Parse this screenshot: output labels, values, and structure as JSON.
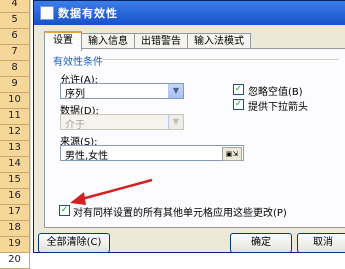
{
  "spreadsheet": {
    "row_numbers": [
      "4",
      "5",
      "6",
      "7",
      "8",
      "9",
      "10",
      "11",
      "12",
      "13",
      "14",
      "15",
      "16",
      "17",
      "18",
      "19",
      "20"
    ]
  },
  "dialog": {
    "title": "数据有效性",
    "tabs": [
      {
        "label": "设置",
        "active": true
      },
      {
        "label": "输入信息",
        "active": false
      },
      {
        "label": "出错警告",
        "active": false
      },
      {
        "label": "输入法模式",
        "active": false
      }
    ],
    "criteria_group_title": "有效性条件",
    "allow_label": "允许(A):",
    "allow_value": "序列",
    "data_label": "数据(D):",
    "data_value": "介于",
    "ignore_blank_label": "忽略空值(B)",
    "ignore_blank_checked": true,
    "dropdown_label": "提供下拉箭头",
    "dropdown_checked": true,
    "source_label": "来源(S):",
    "source_value": "男性,女性",
    "apply_all_label": "对有同样设置的所有其他单元格应用这些更改(P)",
    "apply_all_checked": true,
    "clear_all_button": "全部清除(C)",
    "ok_button": "确定",
    "cancel_button": "取消"
  },
  "colors": {
    "title_bar": "#1750c9",
    "dialog_bg": "#ece9d8",
    "annotation_arrow": "#d42020"
  },
  "icons": {
    "checkmark": "checkmark-icon",
    "dropdown": "chevron-down-icon",
    "range_select": "range-select-icon"
  }
}
